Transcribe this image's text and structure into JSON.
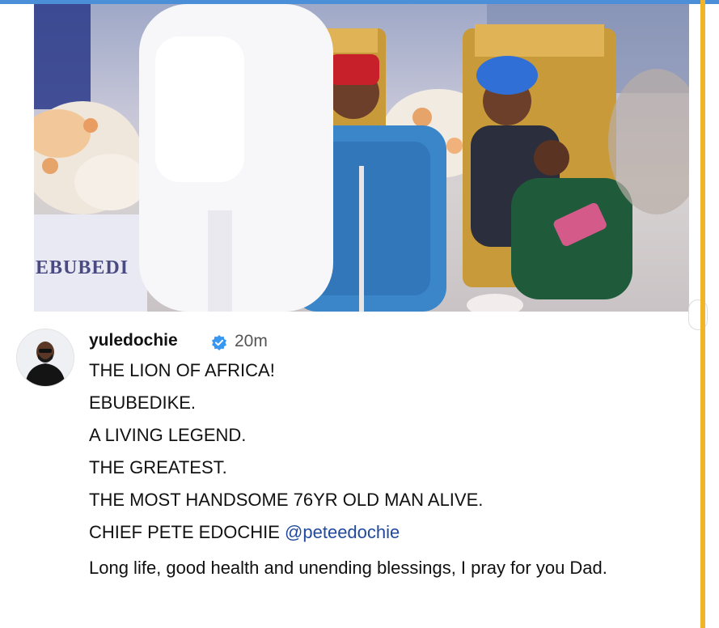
{
  "post": {
    "photo_banner_text": "EBUBEDI",
    "author": "yuledochie",
    "timestamp": "20m",
    "verified_icon": "verified-badge-icon",
    "caption_lines": [
      "THE LION OF AFRICA!",
      "EBUBEDIKE.",
      "A LIVING LEGEND.",
      "THE GREATEST.",
      "THE MOST HANDSOME 76YR OLD MAN ALIVE."
    ],
    "chief_line": "CHIEF PETE EDOCHIE",
    "mention": "@peteedochie",
    "blessing": "Long life, good health and unending blessings, I pray for you Dad."
  },
  "colors": {
    "accent_gold": "#f0b429",
    "verified_blue": "#3897f0",
    "mention_blue": "#214a9e",
    "top_border": "#4a8fd8"
  }
}
